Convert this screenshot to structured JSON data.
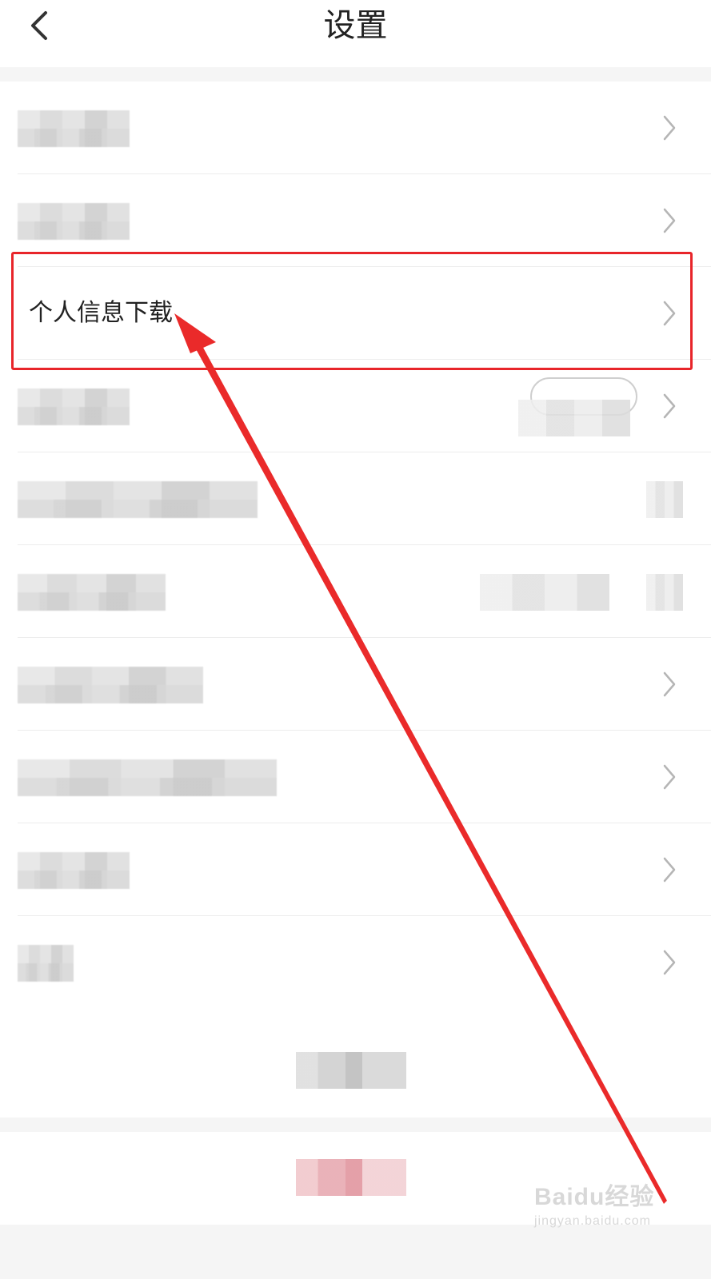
{
  "header": {
    "title": "设置",
    "back_icon": "chevron-left-icon"
  },
  "settings_list": {
    "highlighted_item": {
      "label": "个人信息下载",
      "icon": "chevron-right-icon"
    },
    "row_icon": "chevron-right-icon",
    "blurred_rows": 10
  },
  "watermark": {
    "brand": "Baidu经验",
    "url": "jingyan.baidu.com"
  },
  "colors": {
    "highlight": "#e8252a",
    "accent_red": "#e1969f"
  }
}
